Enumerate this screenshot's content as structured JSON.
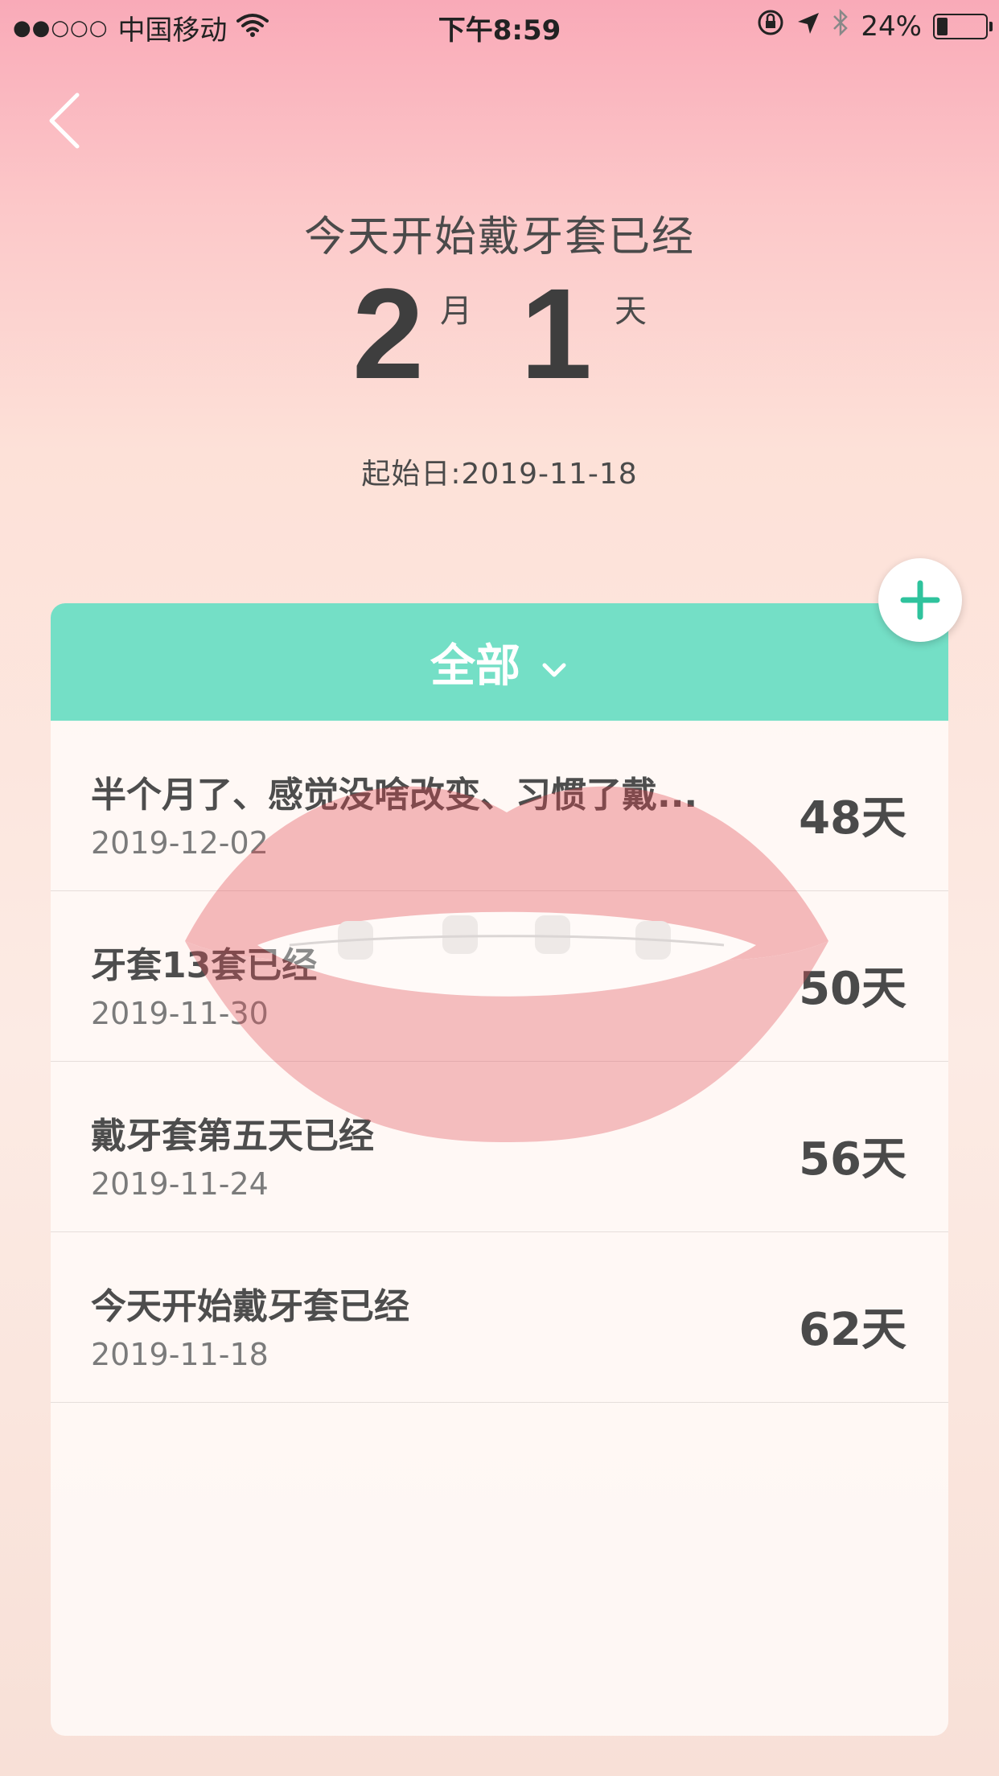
{
  "status_bar": {
    "signal": "●●○○○",
    "carrier": "中国移动",
    "time": "下午8:59",
    "battery": "24%",
    "battery_level": 0.24
  },
  "hero": {
    "title": "今天开始戴牙套已经",
    "months": "2",
    "month_unit": "月",
    "days": "1",
    "day_unit": "天",
    "start_date": "起始日:2019-11-18"
  },
  "filter": {
    "label": "全部"
  },
  "entries": [
    {
      "title": "半个月了、感觉没啥改变、习惯了戴...",
      "date": "2019-12-02",
      "days": "48天"
    },
    {
      "title": "牙套13套已经",
      "date": "2019-11-30",
      "days": "50天"
    },
    {
      "title": "戴牙套第五天已经",
      "date": "2019-11-24",
      "days": "56天"
    },
    {
      "title": "今天开始戴牙套已经",
      "date": "2019-11-18",
      "days": "62天"
    }
  ],
  "colors": {
    "accent": "#74dfc6",
    "add_icon": "#2fc39d",
    "background_top": "#f9aab8",
    "background_bottom": "#f8e0d7"
  },
  "icons": [
    "wifi-icon",
    "back-chevron-icon",
    "chevron-down-icon",
    "plus-icon",
    "orientation-lock-icon",
    "location-icon",
    "bluetooth-icon",
    "battery-icon"
  ]
}
